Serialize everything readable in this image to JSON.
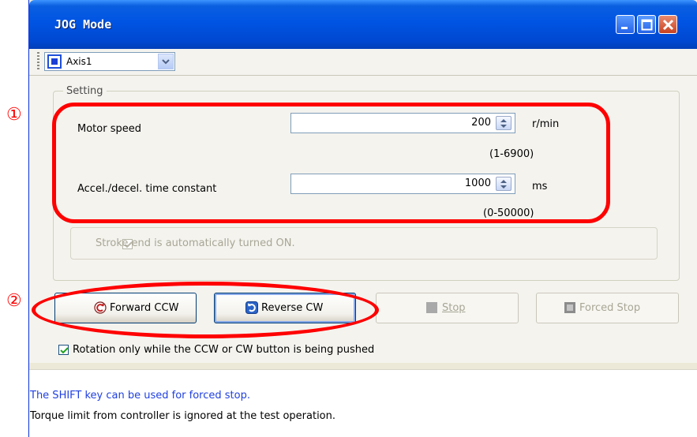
{
  "window": {
    "title": "JOG Mode"
  },
  "toolbar": {
    "axis_selected": "Axis1"
  },
  "setting": {
    "legend": "Setting",
    "motor_speed": {
      "label": "Motor speed",
      "value": "200",
      "unit": "r/min",
      "range": "(1-6900)"
    },
    "accel": {
      "label": "Accel./decel. time constant",
      "value": "1000",
      "unit": "ms",
      "range": "(0-50000)"
    },
    "stroke_end": {
      "label": "Stroke end is automatically turned ON.",
      "checked": true
    }
  },
  "buttons": {
    "forward": "Forward CCW",
    "reverse": "Reverse CW",
    "stop": "Stop",
    "forced_stop": "Forced Stop"
  },
  "rotation_option": {
    "label": "Rotation only while the CCW or CW button is being pushed",
    "checked": true
  },
  "info": {
    "line1": "The SHIFT key can be used for forced stop.",
    "line2": "Torque limit from controller is ignored at the test operation."
  },
  "annotations": {
    "marker1": "①",
    "marker2": "②"
  },
  "colors": {
    "annotation": "#ff0000",
    "titlebar": "#0054e3",
    "info_text": "#2040e0"
  },
  "icons": [
    "axis-icon",
    "chevron-down-icon",
    "spinner-icon",
    "rotate-ccw-icon",
    "rotate-cw-icon",
    "stop-icon",
    "checkmark-icon",
    "minimize-icon",
    "maximize-icon",
    "close-icon"
  ]
}
